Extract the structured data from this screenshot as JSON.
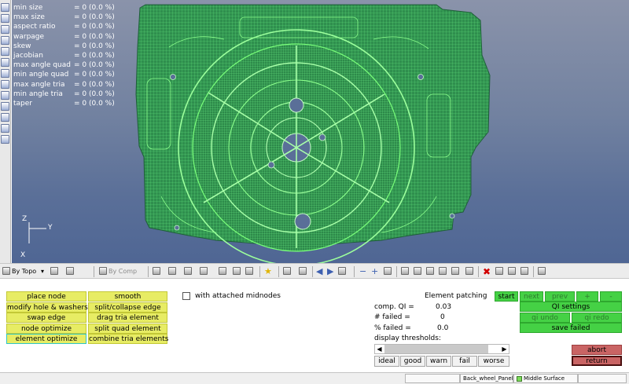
{
  "quality_stats": [
    {
      "name": "min size",
      "value": "= 0 (0.0 %)"
    },
    {
      "name": "max size",
      "value": "= 0 (0.0 %)"
    },
    {
      "name": "aspect ratio",
      "value": "= 0 (0.0 %)"
    },
    {
      "name": "warpage",
      "value": "= 0 (0.0 %)"
    },
    {
      "name": "skew",
      "value": "= 0 (0.0 %)"
    },
    {
      "name": "jacobian",
      "value": "= 0 (0.0 %)"
    },
    {
      "name": "max angle quad",
      "value": "= 0 (0.0 %)"
    },
    {
      "name": "min angle quad",
      "value": "= 0 (0.0 %)"
    },
    {
      "name": "max angle tria",
      "value": "= 0 (0.0 %)"
    },
    {
      "name": "min angle tria",
      "value": "= 0 (0.0 %)"
    },
    {
      "name": "taper",
      "value": "= 0 (0.0 %)"
    }
  ],
  "axis": {
    "x": "X",
    "y": "Y",
    "z": "Z"
  },
  "toolbar": {
    "by_topo": "By Topo",
    "by_comp": "By Comp"
  },
  "tools": [
    {
      "label": "place node"
    },
    {
      "label": "smooth"
    },
    {
      "label": "modify hole & washers"
    },
    {
      "label": "split/collapse edge"
    },
    {
      "label": "swap edge"
    },
    {
      "label": "drag tria element"
    },
    {
      "label": "node optimize"
    },
    {
      "label": "split quad element"
    },
    {
      "label": "element optimize"
    },
    {
      "label": "combine tria elements"
    }
  ],
  "midnodes_label": "with attached midnodes",
  "patching": {
    "title": "Element patching",
    "comp_qi_label": "comp. QI =",
    "comp_qi_value": "0.03",
    "failed_label": "# failed =",
    "failed_value": "0",
    "pct_failed_label": "% failed =",
    "pct_failed_value": "0.0",
    "thresholds_label": "display thresholds:",
    "thresholds": [
      "ideal",
      "good",
      "warn",
      "fail",
      "worse"
    ]
  },
  "qi_controls": {
    "start": "start",
    "next": "next",
    "prev": "prev",
    "plus": "+",
    "minus": "-",
    "qi_settings": "QI settings",
    "qi_undo": "qi undo",
    "qi_redo": "qi redo",
    "save_failed": "save failed"
  },
  "actions": {
    "abort": "abort",
    "return": "return"
  },
  "status": {
    "component": "Back_wheel_Panel",
    "surface": "Middle Surface"
  },
  "colors": {
    "tool_button": "#e7ec64",
    "qi_button": "#45d145",
    "action_button": "#c96464",
    "mesh": "#33e233"
  }
}
